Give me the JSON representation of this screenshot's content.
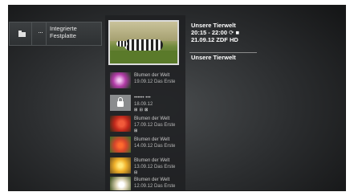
{
  "top_tiles": {
    "folder_tile_icon": "folder-icon",
    "more_tile_label": "···",
    "storage_tile_label_line1": "Integrierte",
    "storage_tile_label_line2": "Festplatte"
  },
  "selected_recording": {
    "title": "Unsere Tierwelt",
    "time": "20:15 - 22:00",
    "time_icons": "⟳ ■",
    "date_channel": "21.09.12  ZDF HD",
    "footer_title": "Unsere Tierwelt",
    "thumbnail_icon": "zebra-thumbnail"
  },
  "recordings": [
    {
      "line1": "Blumen der Welt",
      "line2": "19.09.12 Das Erste",
      "flags": ""
    },
    {
      "line1": "•••••• •••",
      "line2": "18.09.12",
      "flags": "⊞ ⊟ ⊠"
    },
    {
      "line1": "Blumen der Welt",
      "line2": "17.09.12 Das Erste",
      "flags": "⊞"
    },
    {
      "line1": "Blumen der Welt",
      "line2": "14.09.12 Das Erste",
      "flags": ""
    },
    {
      "line1": "Blumen der Welt",
      "line2": "13.09.12 Das Erste",
      "flags": "⊟"
    },
    {
      "line1": "Blumen der Welt",
      "line2": "12.09.12 Das Erste",
      "flags": ""
    }
  ],
  "colors": {
    "background": "#2c2e30",
    "accent_border": "#dcdcdc",
    "text": "#ffffff"
  }
}
